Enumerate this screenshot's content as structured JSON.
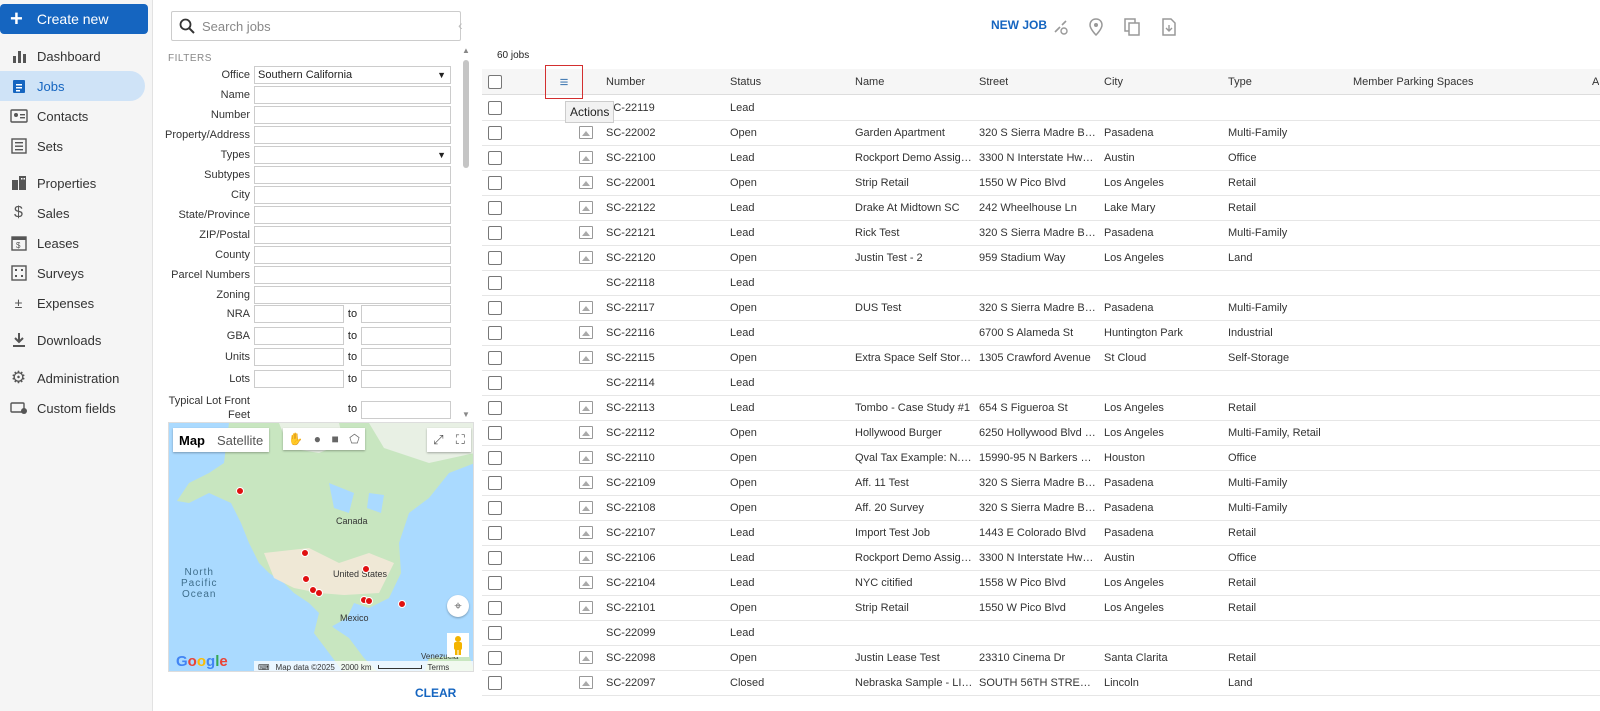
{
  "nav": {
    "create_label": "Create new",
    "items": [
      {
        "label": "Dashboard",
        "icon": "bar-chart-icon",
        "active": false
      },
      {
        "label": "Jobs",
        "icon": "clipboard-icon",
        "active": true
      },
      {
        "label": "Contacts",
        "icon": "contact-card-icon",
        "active": false
      },
      {
        "label": "Sets",
        "icon": "list-icon",
        "active": false
      },
      {
        "label": "Properties",
        "icon": "buildings-icon",
        "active": false
      },
      {
        "label": "Sales",
        "icon": "dollar-icon",
        "active": false
      },
      {
        "label": "Leases",
        "icon": "lease-calendar-icon",
        "active": false
      },
      {
        "label": "Surveys",
        "icon": "survey-grid-icon",
        "active": false
      },
      {
        "label": "Expenses",
        "icon": "plus-minus-icon",
        "active": false
      },
      {
        "label": "Downloads",
        "icon": "download-icon",
        "active": false
      },
      {
        "label": "Administration",
        "icon": "gear-icon",
        "active": false
      },
      {
        "label": "Custom fields",
        "icon": "custom-fields-icon",
        "active": false
      }
    ]
  },
  "filters": {
    "search_placeholder": "Search jobs",
    "title": "FILTERS",
    "office_label": "Office",
    "office_value": "Southern California",
    "fields": [
      {
        "label": "Name"
      },
      {
        "label": "Number"
      },
      {
        "label": "Property/Address"
      },
      {
        "label": "Types",
        "select": true
      },
      {
        "label": "Subtypes"
      },
      {
        "label": "City"
      },
      {
        "label": "State/Province"
      },
      {
        "label": "ZIP/Postal"
      },
      {
        "label": "County"
      },
      {
        "label": "Parcel Numbers"
      },
      {
        "label": "Zoning"
      }
    ],
    "ranges": [
      {
        "label": "NRA"
      },
      {
        "label": "GBA"
      },
      {
        "label": "Units"
      },
      {
        "label": "Lots"
      }
    ],
    "range_to": "to",
    "lot_front_label": "Typical Lot Front",
    "lot_front_label2": "Feet",
    "clear_label": "CLEAR"
  },
  "map": {
    "map_label": "Map",
    "satellite_label": "Satellite",
    "labels": {
      "canada": "Canada",
      "us": "United States",
      "mexico": "Mexico",
      "ocean1": "North",
      "ocean2": "Pacific",
      "ocean3": "Ocean",
      "venezuela": "Venezuela"
    },
    "footer": {
      "data": "Map data ©2025",
      "scale": "2000 km",
      "terms": "Terms"
    },
    "logo": "Google"
  },
  "toolbar": {
    "new_job": "NEW JOB",
    "job_count": "60 jobs"
  },
  "grid": {
    "actions_tooltip": "Actions",
    "columns": [
      "Number",
      "Status",
      "Name",
      "Street",
      "City",
      "Type",
      "Member Parking Spaces",
      "A"
    ],
    "rows": [
      {
        "number": "SC-22119",
        "status": "Lead",
        "name": "",
        "street": "",
        "city": "",
        "type": "",
        "thumb": false
      },
      {
        "number": "SC-22002",
        "status": "Open",
        "name": "Garden Apartment",
        "street": "320 S Sierra Madre Blvd",
        "city": "Pasadena",
        "type": "Multi-Family",
        "thumb": true
      },
      {
        "number": "SC-22100",
        "status": "Lead",
        "name": "Rockport Demo Assign...",
        "street": "3300 N Interstate Hwy ...",
        "city": "Austin",
        "type": "Office",
        "thumb": true
      },
      {
        "number": "SC-22001",
        "status": "Open",
        "name": "Strip Retail",
        "street": "1550 W Pico Blvd",
        "city": "Los Angeles",
        "type": "Retail",
        "thumb": true
      },
      {
        "number": "SC-22122",
        "status": "Lead",
        "name": "Drake At Midtown SC",
        "street": "242 Wheelhouse Ln",
        "city": "Lake Mary",
        "type": "Retail",
        "thumb": true
      },
      {
        "number": "SC-22121",
        "status": "Lead",
        "name": "Rick Test",
        "street": "320 S Sierra Madre Blvd",
        "city": "Pasadena",
        "type": "Multi-Family",
        "thumb": true
      },
      {
        "number": "SC-22120",
        "status": "Open",
        "name": "Justin Test - 2",
        "street": "959 Stadium Way",
        "city": "Los Angeles",
        "type": "Land",
        "thumb": true
      },
      {
        "number": "SC-22118",
        "status": "Lead",
        "name": "",
        "street": "",
        "city": "",
        "type": "",
        "thumb": false
      },
      {
        "number": "SC-22117",
        "status": "Open",
        "name": "DUS Test",
        "street": "320 S Sierra Madre Blvd",
        "city": "Pasadena",
        "type": "Multi-Family",
        "thumb": true
      },
      {
        "number": "SC-22116",
        "status": "Lead",
        "name": "",
        "street": "6700 S Alameda St",
        "city": "Huntington Park",
        "type": "Industrial",
        "thumb": true
      },
      {
        "number": "SC-22115",
        "status": "Open",
        "name": "Extra Space Self Storage",
        "street": "1305 Crawford Avenue",
        "city": "St Cloud",
        "type": "Self-Storage",
        "thumb": true
      },
      {
        "number": "SC-22114",
        "status": "Lead",
        "name": "",
        "street": "",
        "city": "",
        "type": "",
        "thumb": false
      },
      {
        "number": "SC-22113",
        "status": "Lead",
        "name": "Tombo - Case Study #1",
        "street": "654 S Figueroa St",
        "city": "Los Angeles",
        "type": "Retail",
        "thumb": true
      },
      {
        "number": "SC-22112",
        "status": "Open",
        "name": "Hollywood Burger",
        "street": "6250 Hollywood Blvd U...",
        "city": "Los Angeles",
        "type": "Multi-Family, Retail",
        "thumb": true
      },
      {
        "number": "SC-22110",
        "status": "Open",
        "name": "Qval Tax Example: N. Ba...",
        "street": "15990-95 N Barkers La...",
        "city": "Houston",
        "type": "Office",
        "thumb": true
      },
      {
        "number": "SC-22109",
        "status": "Open",
        "name": "Aff. 11 Test",
        "street": "320 S Sierra Madre Blvd",
        "city": "Pasadena",
        "type": "Multi-Family",
        "thumb": true
      },
      {
        "number": "SC-22108",
        "status": "Open",
        "name": "Aff. 20 Survey",
        "street": "320 S Sierra Madre Blvd",
        "city": "Pasadena",
        "type": "Multi-Family",
        "thumb": true
      },
      {
        "number": "SC-22107",
        "status": "Lead",
        "name": "Import Test Job",
        "street": "1443 E Colorado Blvd",
        "city": "Pasadena",
        "type": "Retail",
        "thumb": true
      },
      {
        "number": "SC-22106",
        "status": "Lead",
        "name": "Rockport Demo Assign...",
        "street": "3300 N Interstate Hwy ...",
        "city": "Austin",
        "type": "Office",
        "thumb": true
      },
      {
        "number": "SC-22104",
        "status": "Lead",
        "name": "NYC citified",
        "street": "1558 W Pico Blvd",
        "city": "Los Angeles",
        "type": "Retail",
        "thumb": true
      },
      {
        "number": "SC-22101",
        "status": "Open",
        "name": "Strip Retail",
        "street": "1550 W Pico Blvd",
        "city": "Los Angeles",
        "type": "Retail",
        "thumb": true
      },
      {
        "number": "SC-22099",
        "status": "Lead",
        "name": "",
        "street": "",
        "city": "",
        "type": "",
        "thumb": false
      },
      {
        "number": "SC-22098",
        "status": "Open",
        "name": "Justin Lease Test",
        "street": "23310 Cinema Dr",
        "city": "Santa Clarita",
        "type": "Retail",
        "thumb": true
      },
      {
        "number": "SC-22097",
        "status": "Closed",
        "name": "Nebraska Sample - LIN...",
        "street": "SOUTH 56TH STREET B...",
        "city": "Lincoln",
        "type": "Land",
        "thumb": true
      }
    ]
  },
  "colors": {
    "accent": "#1565c0",
    "nav_active_bg": "#cfe3f7",
    "highlight_border": "#d32f2f",
    "map_pin": "#e01010"
  }
}
